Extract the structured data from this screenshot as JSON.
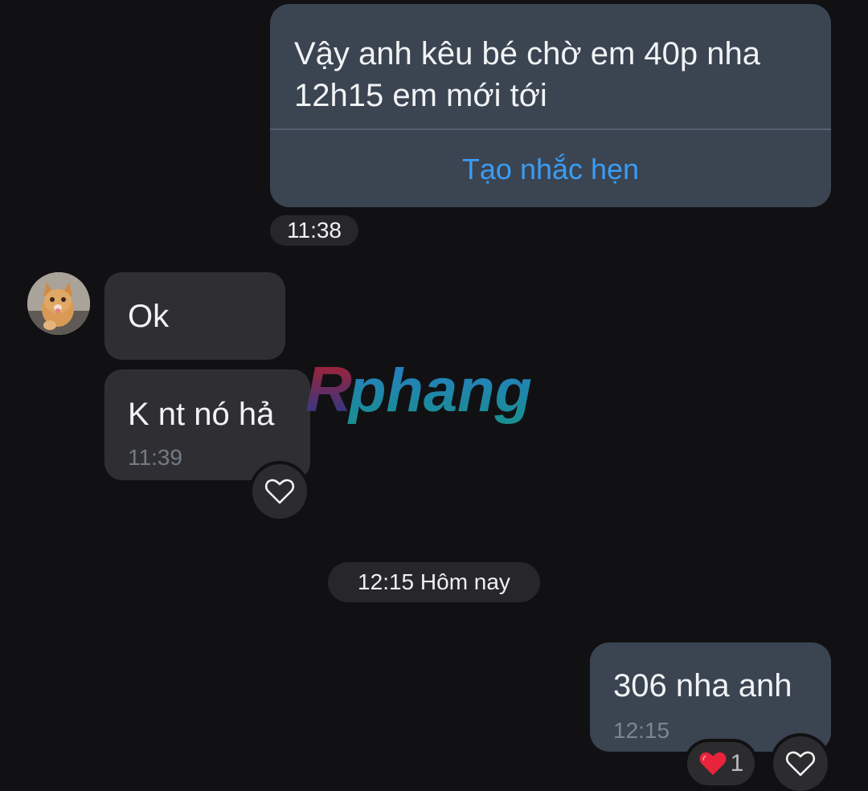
{
  "conversation": {
    "reminder_message": {
      "text": "Vậy anh kêu bé chờ em 40p nha 12h15 em mới tới",
      "action_label": "Tạo nhắc hẹn",
      "time": "11:38"
    },
    "received_messages": [
      {
        "text": "Ok"
      },
      {
        "text": "K nt nó hả",
        "time": "11:39"
      }
    ],
    "date_separator": "12:15 Hôm nay",
    "sent_message": {
      "text": "306 nha anh",
      "time": "12:15",
      "reaction_count": "1"
    }
  },
  "watermark": {
    "text": "Rphang"
  },
  "icons": {
    "react": "heart-outline-icon",
    "reaction": "red-heart-icon",
    "avatar": "cat-avatar"
  },
  "colors": {
    "background": "#111113",
    "sent_bubble": "#3b4451",
    "received_bubble": "#2f2f33",
    "link": "#3a9df3",
    "heart": "#e8243b"
  }
}
